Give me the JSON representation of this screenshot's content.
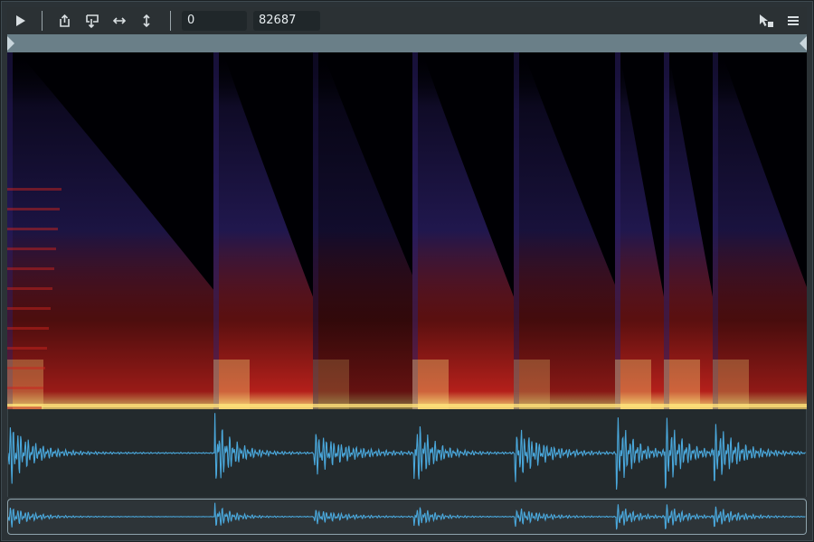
{
  "toolbar": {
    "play_icon": "play-icon",
    "selection_start": "0",
    "selection_end": "82687"
  },
  "spectrogram": {
    "onsets": [
      0,
      228,
      338,
      448,
      560,
      672,
      726,
      780
    ],
    "strength": [
      0.85,
      1.0,
      0.55,
      1.0,
      0.75,
      1.0,
      1.0,
      0.8
    ]
  },
  "colors": {
    "waveform": "#4aa8dc",
    "overview_waveform": "#4aa8dc",
    "ruler": "#6a7f88",
    "spectro_low": "#2b1f66",
    "spectro_mid": "#c8231d",
    "spectro_high": "#ffe27a"
  }
}
